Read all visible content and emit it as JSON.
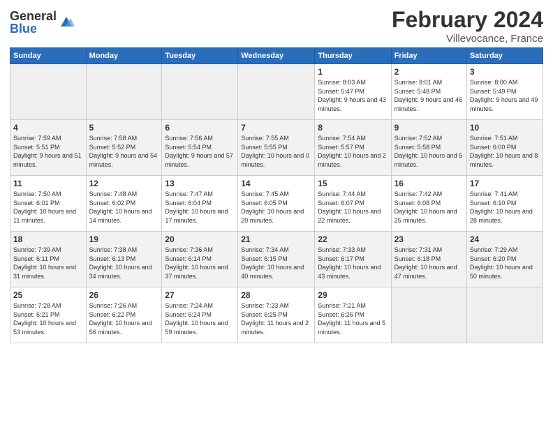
{
  "logo": {
    "general": "General",
    "blue": "Blue"
  },
  "header": {
    "month": "February 2024",
    "location": "Villevocance, France"
  },
  "columns": [
    "Sunday",
    "Monday",
    "Tuesday",
    "Wednesday",
    "Thursday",
    "Friday",
    "Saturday"
  ],
  "weeks": [
    [
      {
        "day": "",
        "sunrise": "",
        "sunset": "",
        "daylight": "",
        "empty": true
      },
      {
        "day": "",
        "sunrise": "",
        "sunset": "",
        "daylight": "",
        "empty": true
      },
      {
        "day": "",
        "sunrise": "",
        "sunset": "",
        "daylight": "",
        "empty": true
      },
      {
        "day": "",
        "sunrise": "",
        "sunset": "",
        "daylight": "",
        "empty": true
      },
      {
        "day": "1",
        "sunrise": "Sunrise: 8:03 AM",
        "sunset": "Sunset: 5:47 PM",
        "daylight": "Daylight: 9 hours and 43 minutes.",
        "empty": false
      },
      {
        "day": "2",
        "sunrise": "Sunrise: 8:01 AM",
        "sunset": "Sunset: 5:48 PM",
        "daylight": "Daylight: 9 hours and 46 minutes.",
        "empty": false
      },
      {
        "day": "3",
        "sunrise": "Sunrise: 8:00 AM",
        "sunset": "Sunset: 5:49 PM",
        "daylight": "Daylight: 9 hours and 49 minutes.",
        "empty": false
      }
    ],
    [
      {
        "day": "4",
        "sunrise": "Sunrise: 7:59 AM",
        "sunset": "Sunset: 5:51 PM",
        "daylight": "Daylight: 9 hours and 51 minutes.",
        "empty": false
      },
      {
        "day": "5",
        "sunrise": "Sunrise: 7:58 AM",
        "sunset": "Sunset: 5:52 PM",
        "daylight": "Daylight: 9 hours and 54 minutes.",
        "empty": false
      },
      {
        "day": "6",
        "sunrise": "Sunrise: 7:56 AM",
        "sunset": "Sunset: 5:54 PM",
        "daylight": "Daylight: 9 hours and 57 minutes.",
        "empty": false
      },
      {
        "day": "7",
        "sunrise": "Sunrise: 7:55 AM",
        "sunset": "Sunset: 5:55 PM",
        "daylight": "Daylight: 10 hours and 0 minutes.",
        "empty": false
      },
      {
        "day": "8",
        "sunrise": "Sunrise: 7:54 AM",
        "sunset": "Sunset: 5:57 PM",
        "daylight": "Daylight: 10 hours and 2 minutes.",
        "empty": false
      },
      {
        "day": "9",
        "sunrise": "Sunrise: 7:52 AM",
        "sunset": "Sunset: 5:58 PM",
        "daylight": "Daylight: 10 hours and 5 minutes.",
        "empty": false
      },
      {
        "day": "10",
        "sunrise": "Sunrise: 7:51 AM",
        "sunset": "Sunset: 6:00 PM",
        "daylight": "Daylight: 10 hours and 8 minutes.",
        "empty": false
      }
    ],
    [
      {
        "day": "11",
        "sunrise": "Sunrise: 7:50 AM",
        "sunset": "Sunset: 6:01 PM",
        "daylight": "Daylight: 10 hours and 11 minutes.",
        "empty": false
      },
      {
        "day": "12",
        "sunrise": "Sunrise: 7:48 AM",
        "sunset": "Sunset: 6:02 PM",
        "daylight": "Daylight: 10 hours and 14 minutes.",
        "empty": false
      },
      {
        "day": "13",
        "sunrise": "Sunrise: 7:47 AM",
        "sunset": "Sunset: 6:04 PM",
        "daylight": "Daylight: 10 hours and 17 minutes.",
        "empty": false
      },
      {
        "day": "14",
        "sunrise": "Sunrise: 7:45 AM",
        "sunset": "Sunset: 6:05 PM",
        "daylight": "Daylight: 10 hours and 20 minutes.",
        "empty": false
      },
      {
        "day": "15",
        "sunrise": "Sunrise: 7:44 AM",
        "sunset": "Sunset: 6:07 PM",
        "daylight": "Daylight: 10 hours and 22 minutes.",
        "empty": false
      },
      {
        "day": "16",
        "sunrise": "Sunrise: 7:42 AM",
        "sunset": "Sunset: 6:08 PM",
        "daylight": "Daylight: 10 hours and 25 minutes.",
        "empty": false
      },
      {
        "day": "17",
        "sunrise": "Sunrise: 7:41 AM",
        "sunset": "Sunset: 6:10 PM",
        "daylight": "Daylight: 10 hours and 28 minutes.",
        "empty": false
      }
    ],
    [
      {
        "day": "18",
        "sunrise": "Sunrise: 7:39 AM",
        "sunset": "Sunset: 6:11 PM",
        "daylight": "Daylight: 10 hours and 31 minutes.",
        "empty": false
      },
      {
        "day": "19",
        "sunrise": "Sunrise: 7:38 AM",
        "sunset": "Sunset: 6:13 PM",
        "daylight": "Daylight: 10 hours and 34 minutes.",
        "empty": false
      },
      {
        "day": "20",
        "sunrise": "Sunrise: 7:36 AM",
        "sunset": "Sunset: 6:14 PM",
        "daylight": "Daylight: 10 hours and 37 minutes.",
        "empty": false
      },
      {
        "day": "21",
        "sunrise": "Sunrise: 7:34 AM",
        "sunset": "Sunset: 6:15 PM",
        "daylight": "Daylight: 10 hours and 40 minutes.",
        "empty": false
      },
      {
        "day": "22",
        "sunrise": "Sunrise: 7:33 AM",
        "sunset": "Sunset: 6:17 PM",
        "daylight": "Daylight: 10 hours and 43 minutes.",
        "empty": false
      },
      {
        "day": "23",
        "sunrise": "Sunrise: 7:31 AM",
        "sunset": "Sunset: 6:18 PM",
        "daylight": "Daylight: 10 hours and 47 minutes.",
        "empty": false
      },
      {
        "day": "24",
        "sunrise": "Sunrise: 7:29 AM",
        "sunset": "Sunset: 6:20 PM",
        "daylight": "Daylight: 10 hours and 50 minutes.",
        "empty": false
      }
    ],
    [
      {
        "day": "25",
        "sunrise": "Sunrise: 7:28 AM",
        "sunset": "Sunset: 6:21 PM",
        "daylight": "Daylight: 10 hours and 53 minutes.",
        "empty": false
      },
      {
        "day": "26",
        "sunrise": "Sunrise: 7:26 AM",
        "sunset": "Sunset: 6:22 PM",
        "daylight": "Daylight: 10 hours and 56 minutes.",
        "empty": false
      },
      {
        "day": "27",
        "sunrise": "Sunrise: 7:24 AM",
        "sunset": "Sunset: 6:24 PM",
        "daylight": "Daylight: 10 hours and 59 minutes.",
        "empty": false
      },
      {
        "day": "28",
        "sunrise": "Sunrise: 7:23 AM",
        "sunset": "Sunset: 6:25 PM",
        "daylight": "Daylight: 11 hours and 2 minutes.",
        "empty": false
      },
      {
        "day": "29",
        "sunrise": "Sunrise: 7:21 AM",
        "sunset": "Sunset: 6:26 PM",
        "daylight": "Daylight: 11 hours and 5 minutes.",
        "empty": false
      },
      {
        "day": "",
        "sunrise": "",
        "sunset": "",
        "daylight": "",
        "empty": true
      },
      {
        "day": "",
        "sunrise": "",
        "sunset": "",
        "daylight": "",
        "empty": true
      }
    ]
  ]
}
